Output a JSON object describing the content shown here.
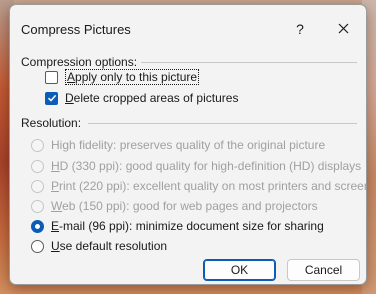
{
  "dialog": {
    "title": "Compress Pictures",
    "help_label": "?",
    "close_icon": "close-icon"
  },
  "compression": {
    "section_label": "Compression options:",
    "apply_only": {
      "label": "Apply only to this picture",
      "checked": false
    },
    "delete_cropped": {
      "label": "Delete cropped areas of pictures",
      "checked": true
    }
  },
  "resolution": {
    "section_label": "Resolution:",
    "options": [
      {
        "label": "High fidelity: preserves quality of the original picture",
        "enabled": false,
        "selected": false
      },
      {
        "label": "HD (330 ppi): good quality for high-definition (HD) displays",
        "enabled": false,
        "selected": false
      },
      {
        "label": "Print (220 ppi): excellent quality on most printers and screens",
        "enabled": false,
        "selected": false
      },
      {
        "label": "Web (150 ppi): good for web pages and projectors",
        "enabled": false,
        "selected": false
      },
      {
        "label": "E-mail (96 ppi): minimize document size for sharing",
        "enabled": true,
        "selected": true
      },
      {
        "label": "Use default resolution",
        "enabled": true,
        "selected": false
      }
    ]
  },
  "buttons": {
    "ok_label": "OK",
    "cancel_label": "Cancel"
  },
  "colors": {
    "accent": "#0a5cb8",
    "dialog_bg": "#f3f3f3",
    "disabled_text": "#a0a0a0"
  }
}
